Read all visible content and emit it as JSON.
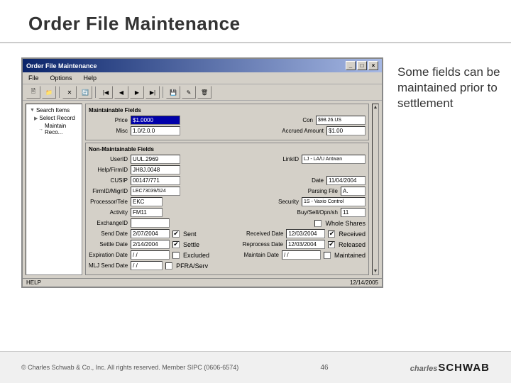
{
  "page": {
    "title": "Order File Maintenance"
  },
  "dialog": {
    "title": "Order File Maintenance",
    "menus": [
      "File",
      "Options",
      "Help"
    ],
    "nav_items": [
      {
        "label": "Search Items",
        "indent": 1
      },
      {
        "label": "Select Record",
        "indent": 2
      },
      {
        "label": "Maintain Reco...",
        "indent": 3
      }
    ],
    "maintainable_section": {
      "title": "Maintainable Fields",
      "fields": [
        {
          "label": "Price",
          "value": "$1.0000",
          "highlight": true
        },
        {
          "label": "Con",
          "value": "$98.26.US"
        },
        {
          "label": "Misc",
          "value": "1.0/2.0.0"
        },
        {
          "label": "Accrued Amount",
          "value": "$1.00"
        }
      ]
    },
    "non_maintainable_section": {
      "title": "Non-Maintainable Fields",
      "rows": [
        [
          {
            "label": "UserID",
            "value": "UUL.2969"
          },
          {
            "label": "LinkID",
            "value": "LJ - LA/U Antwan"
          }
        ],
        [
          {
            "label": "Help/FirmID",
            "value": "JH8J.0048"
          },
          {
            "label": "",
            "value": ""
          }
        ],
        [
          {
            "label": "CUSIP",
            "value": "00147/771"
          },
          {
            "label": "Date",
            "value": "11/04/2004"
          }
        ],
        [
          {
            "label": "FirmID/MigrID",
            "value": "LEC73039/524"
          },
          {
            "label": "Parsing File",
            "value": "A."
          }
        ],
        [
          {
            "label": "Processor/Tele",
            "value": "EKC"
          },
          {
            "label": "Security",
            "value": "1S - Vaxio Control"
          }
        ],
        [
          {
            "label": "Activity",
            "value": "FM11"
          },
          {
            "label": "Buy/Sell/Opn/sh",
            "value": "11"
          }
        ],
        [
          {
            "label": "ExchangeID",
            "value": ""
          },
          {
            "label": "Whole Shares",
            "value": "",
            "checkbox": true
          }
        ],
        [
          {
            "label": "Send Date",
            "value": "2/07/2004"
          },
          {
            "label": "Sent",
            "value": "",
            "checkbox": true,
            "checked": true
          },
          {
            "label": "Received Date",
            "value": "12/03/2004"
          },
          {
            "label": "Received",
            "value": "",
            "checkbox": true,
            "checked": true
          }
        ],
        [
          {
            "label": "Settle Date",
            "value": "2/14/2004"
          },
          {
            "label": "Settle",
            "value": "",
            "checkbox": true,
            "checked": true
          },
          {
            "label": "Reprocess Date",
            "value": "12/03/2004"
          },
          {
            "label": "Released",
            "value": "",
            "checkbox": true,
            "checked": true
          }
        ],
        [
          {
            "label": "Expiration Date",
            "value": "/ /"
          },
          {
            "label": "Excluded",
            "value": "",
            "checkbox": true
          },
          {
            "label": "Maintain Date",
            "value": "/ /"
          },
          {
            "label": "Maintained",
            "value": "",
            "checkbox": true
          }
        ],
        [
          {
            "label": "MLJ Send Date",
            "value": "/ /"
          },
          {
            "label": "PFRA/Serv",
            "value": "",
            "checkbox": true
          }
        ]
      ]
    },
    "status_bar": {
      "left": "HELP",
      "right": "12/14/2005"
    }
  },
  "callout": {
    "text": "Some fields can be maintained prior to settlement"
  },
  "footer": {
    "copyright": "© Charles Schwab & Co., Inc. All rights reserved. Member SIPC (0606-6574)",
    "page_number": "46",
    "logo_charles": "charles",
    "logo_schwab": "SCHWAB"
  }
}
